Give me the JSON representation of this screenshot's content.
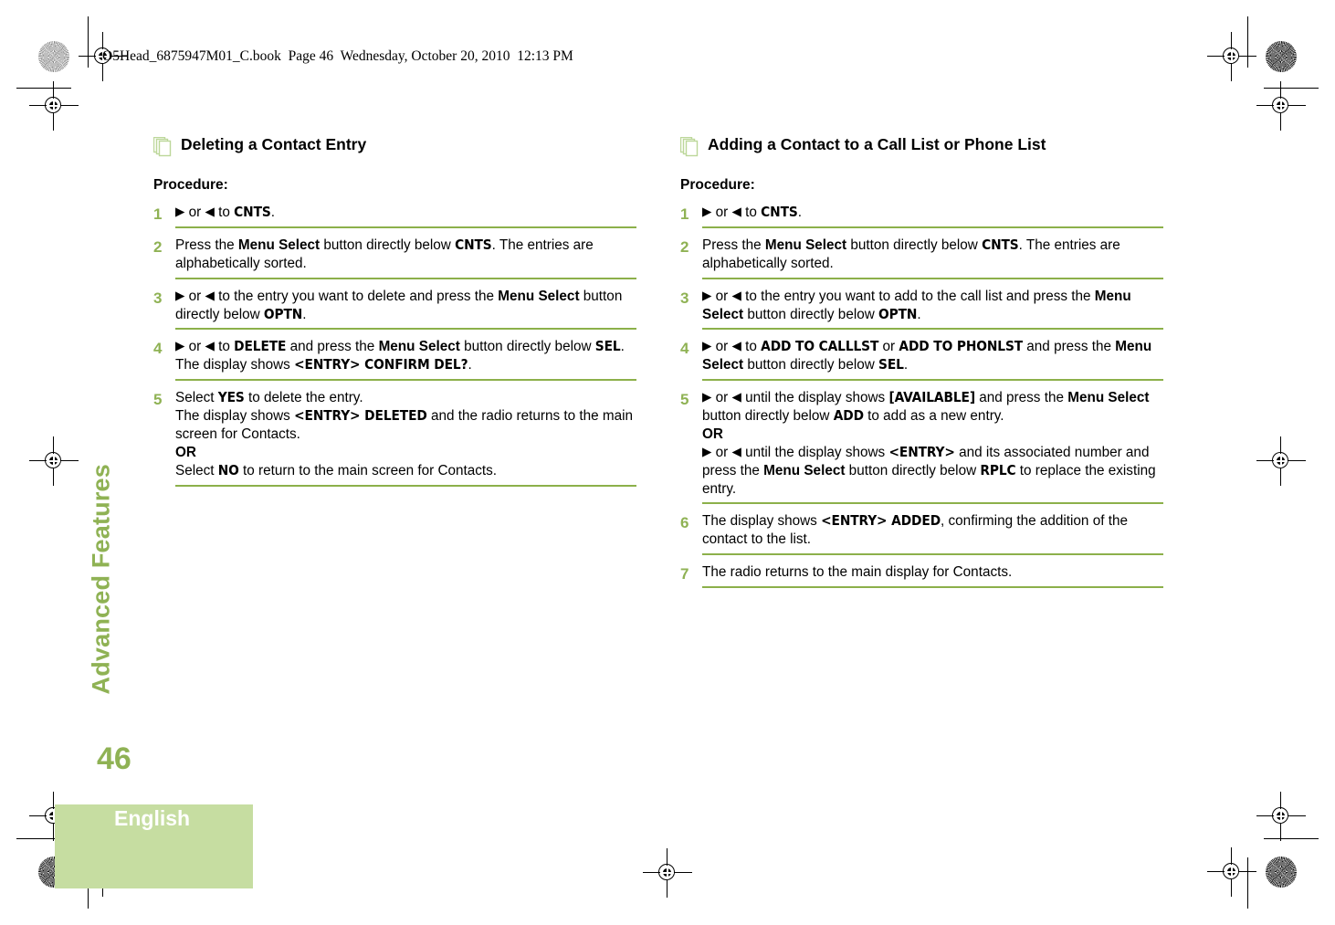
{
  "running_header": "O5Head_6875947M01_C.book  Page 46  Wednesday, October 20, 2010  12:13 PM",
  "sidebar": {
    "chapter_title": "Advanced Features",
    "page_number": "46",
    "language": "English"
  },
  "colors": {
    "accent_green": "#8FB254",
    "rule_green": "#8CB04A",
    "footer_green": "#C6DDA1",
    "icon_outline_green": "#BCD79A"
  },
  "icons": {
    "section": "stacked-pages-icon",
    "arrow_right": "▶",
    "arrow_left": "◀"
  },
  "left_column": {
    "heading": "Deleting a Contact Entry",
    "procedure_label": "Procedure:",
    "steps": [
      {
        "num": "1",
        "text": "▶ or ◀ to CNTS."
      },
      {
        "num": "2",
        "text": "Press the Menu Select button directly below CNTS. The entries are alphabetically sorted."
      },
      {
        "num": "3",
        "text": "▶ or ◀ to the entry you want to delete and press the Menu Select button directly below OPTN."
      },
      {
        "num": "4",
        "text": "▶ or ◀ to DELETE and press the Menu Select button directly below SEL. The display shows <ENTRY> CONFIRM DEL?."
      },
      {
        "num": "5",
        "text": "Select YES to delete the entry. The display shows <ENTRY> DELETED and the radio returns to the main screen for Contacts. OR Select NO to return to the main screen for Contacts."
      }
    ]
  },
  "right_column": {
    "heading": "Adding a Contact to a Call List or Phone List",
    "procedure_label": "Procedure:",
    "steps": [
      {
        "num": "1",
        "text": "▶ or ◀ to CNTS."
      },
      {
        "num": "2",
        "text": "Press the Menu Select button directly below CNTS. The entries are alphabetically sorted."
      },
      {
        "num": "3",
        "text": "▶ or ◀ to the entry you want to add to the call list and press the Menu Select button directly below OPTN."
      },
      {
        "num": "4",
        "text": "▶ or ◀ to ADD TO CALLLST or ADD TO PHONLST and press the Menu Select button directly below SEL."
      },
      {
        "num": "5",
        "text": "▶ or ◀ until the display shows [AVAILABLE] and press the Menu Select button directly below ADD to add as a new entry. OR ▶ or ◀ until the display shows <ENTRY> and its associated number and press the Menu Select button directly below RPLC to replace the existing entry."
      },
      {
        "num": "6",
        "text": "The display shows <ENTRY> ADDED, confirming the addition of the contact to the list."
      },
      {
        "num": "7",
        "text": "The radio returns to the main display for Contacts."
      }
    ]
  }
}
